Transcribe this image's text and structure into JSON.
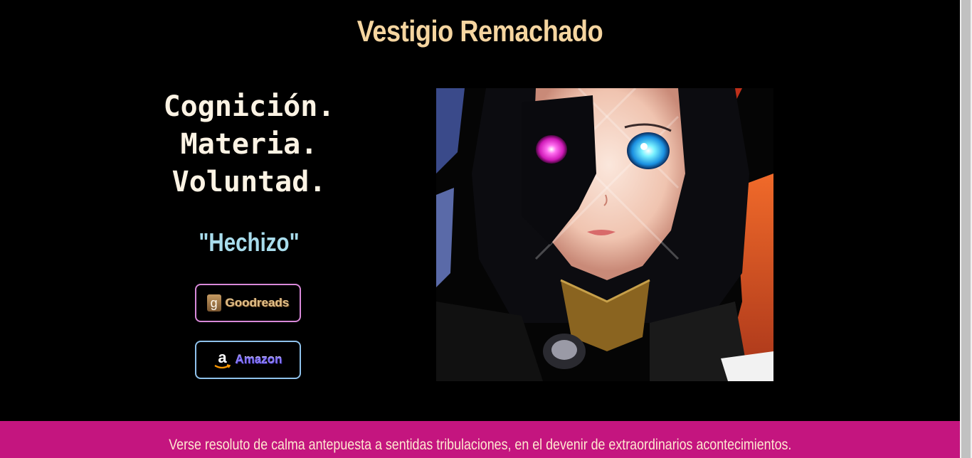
{
  "header": {
    "title": "Vestigio Remachado"
  },
  "tagline": {
    "line1": "Cognición.",
    "line2": "Materia.",
    "line3": "Voluntad."
  },
  "book": {
    "title": "\"Hechizo\""
  },
  "stores": {
    "goodreads": {
      "label": "Goodreads",
      "icon": "goodreads-g-icon",
      "icon_glyph": "g"
    },
    "amazon": {
      "label": "Amazon",
      "icon": "amazon-a-icon",
      "icon_glyph": "a"
    }
  },
  "hero": {
    "alt": "anime girl with heterochromatic eyes, pink and blue"
  },
  "footer": {
    "text": "Verse resoluto de calma antepuesta a sentidas tribulaciones, en el devenir de extraordinarios acontecimientos."
  },
  "colors": {
    "background": "#000000",
    "title": "#f5d5a0",
    "book_title": "#a8dcec",
    "footer_bg": "#c4157f",
    "goodreads_border": "#d889d9",
    "amazon_border": "#8fc2ec"
  }
}
